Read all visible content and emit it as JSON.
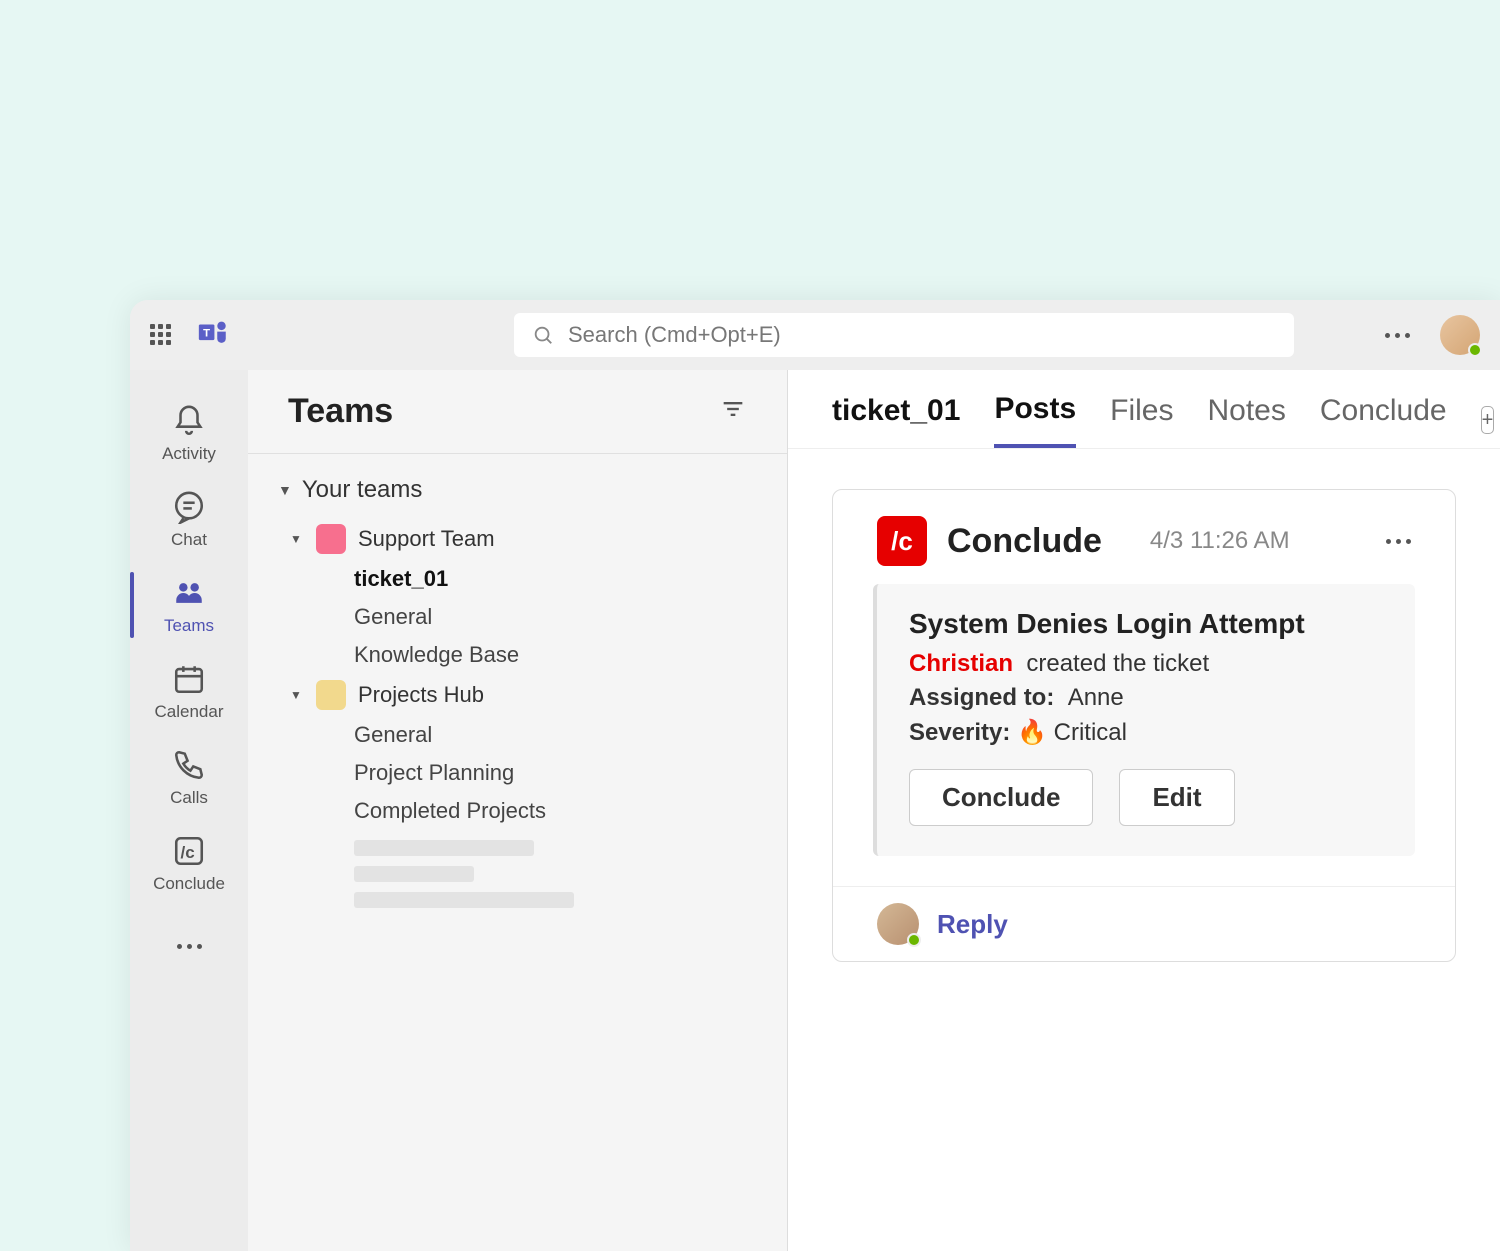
{
  "topbar": {
    "search_placeholder": "Search (Cmd+Opt+E)"
  },
  "rail": {
    "items": [
      {
        "label": "Activity"
      },
      {
        "label": "Chat"
      },
      {
        "label": "Teams"
      },
      {
        "label": "Calendar"
      },
      {
        "label": "Calls"
      },
      {
        "label": "Conclude"
      }
    ]
  },
  "teams_panel": {
    "title": "Teams",
    "section_label": "Your teams",
    "teams": [
      {
        "name": "Support Team",
        "color": "#f76f8e",
        "channels": [
          "ticket_01",
          "General",
          "Knowledge Base"
        ],
        "active_channel": "ticket_01"
      },
      {
        "name": "Projects Hub",
        "color": "#f2d98d",
        "channels": [
          "General",
          "Project Planning",
          "Completed Projects"
        ]
      }
    ]
  },
  "content": {
    "channel_title": "ticket_01",
    "tabs": [
      "Posts",
      "Files",
      "Notes",
      "Conclude"
    ],
    "active_tab": "Posts"
  },
  "post": {
    "app_name": "Conclude",
    "app_icon_text": "/c",
    "timestamp": "4/3 11:26 AM",
    "title": "System Denies Login Attempt",
    "creator": "Christian",
    "created_text": "created the ticket",
    "assigned_label": "Assigned to:",
    "assigned_to": "Anne",
    "severity_label": "Severity:",
    "severity_icon": "🔥",
    "severity_value": "Critical",
    "buttons": {
      "conclude": "Conclude",
      "edit": "Edit"
    },
    "reply_label": "Reply"
  }
}
